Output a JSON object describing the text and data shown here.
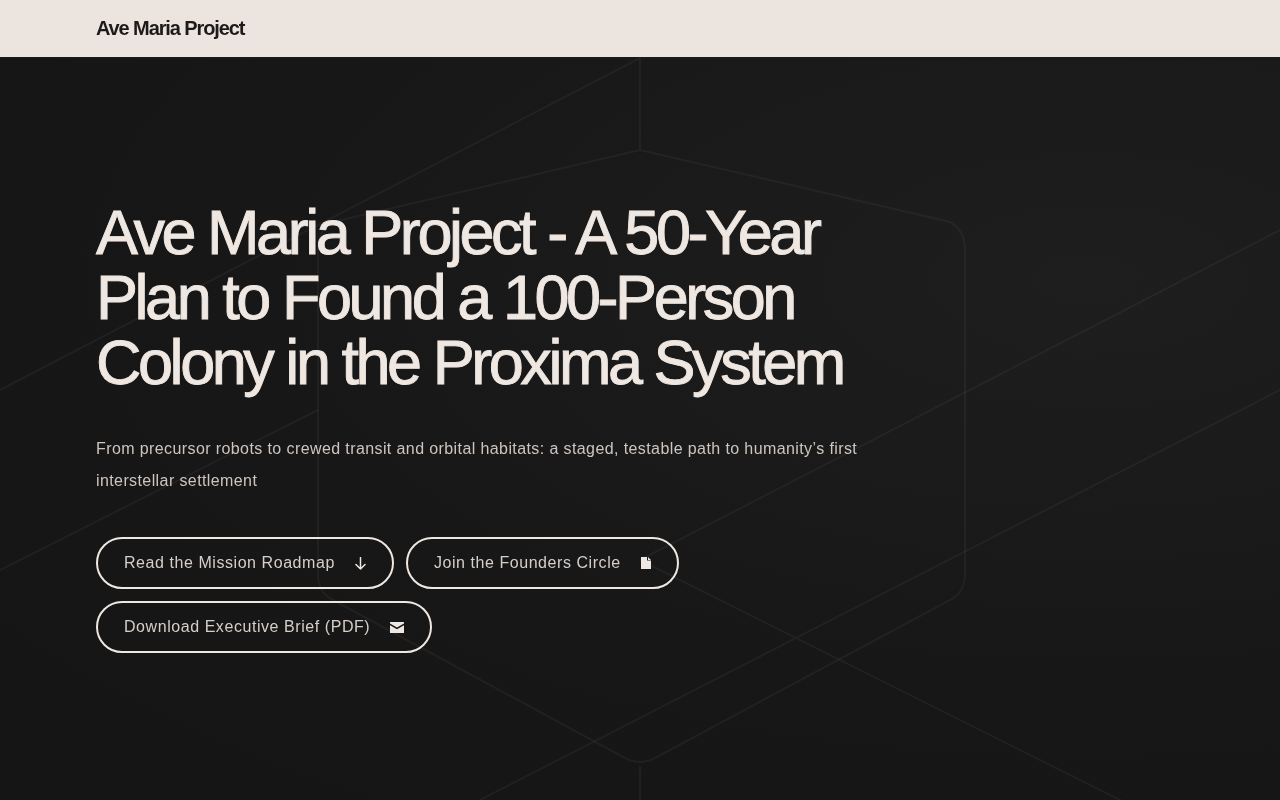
{
  "header": {
    "brand": "Ave Maria Project"
  },
  "hero": {
    "title": "Ave Maria Project - A 50-Year Plan to Found a 100-Person Colony in the Proxima System",
    "subtitle": "From precursor robots to crewed transit and orbital habitats: a staged, testable path to humanity’s first interstellar settlement",
    "buttons": [
      {
        "label": "Read the Mission Roadmap",
        "kind": "navigate"
      },
      {
        "label": "Join the Founders Circle",
        "kind": "join"
      },
      {
        "label": "Download Executive Brief (PDF)",
        "kind": "download"
      }
    ]
  }
}
